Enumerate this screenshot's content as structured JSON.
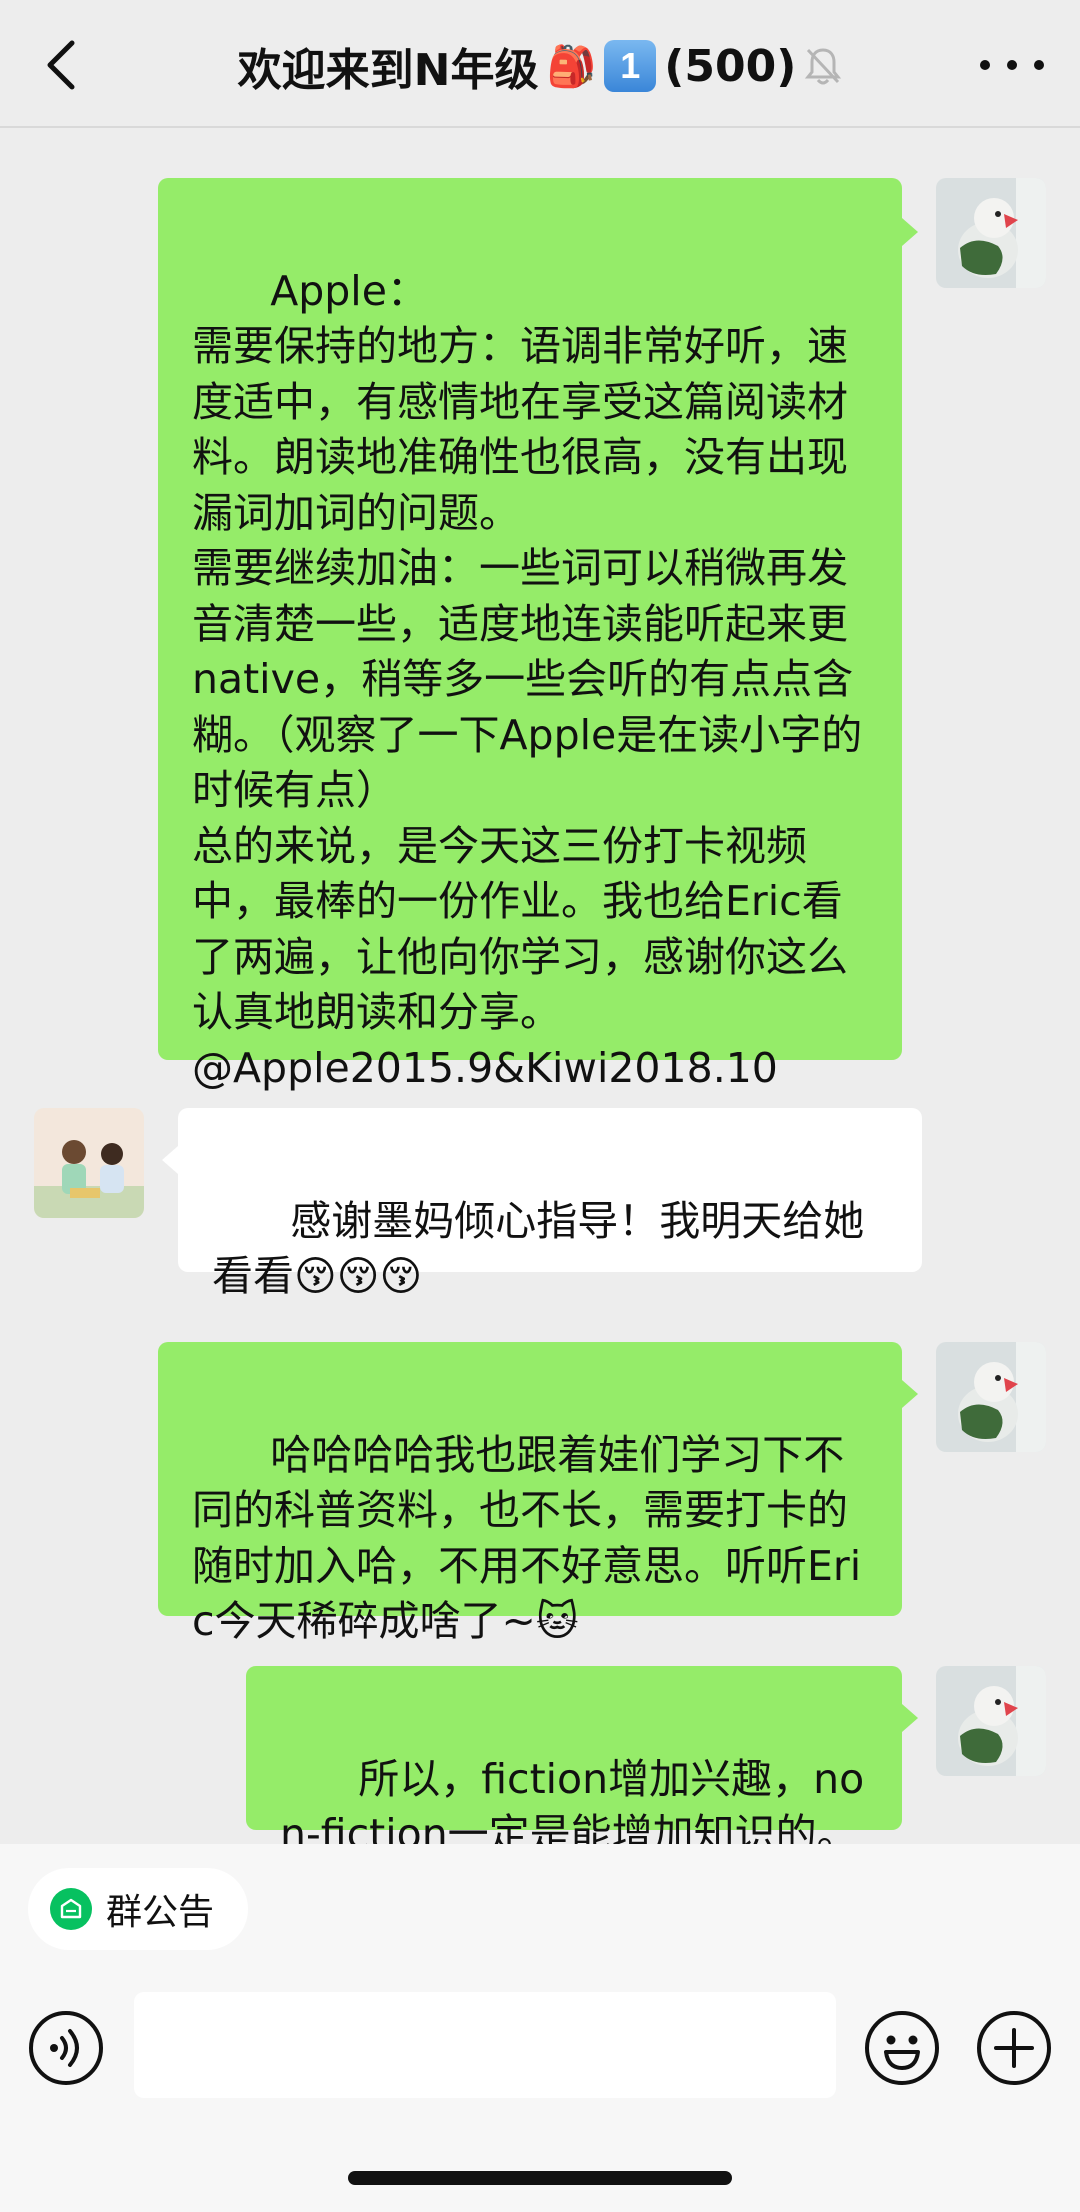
{
  "header": {
    "back_icon": "chevron-left-icon",
    "title": "欢迎来到N年级",
    "title_emoji": "🎒",
    "badge_number": "1",
    "member_count": "(500)",
    "mute_icon": "bell-slash-icon",
    "more_icon": "ellipsis-icon"
  },
  "messages": [
    {
      "side": "right",
      "sender": "self",
      "text": "Apple：\n需要保持的地方：语调非常好听，速度适中，有感情地在享受这篇阅读材料。朗读地准确性也很高，没有出现漏词加词的问题。\n需要继续加油：一些词可以稍微再发音清楚一些，适度地连读能听起来更native，稍等多一些会听的有点点含糊。（观察了一下Apple是在读小字的时候有点）\n总的来说，是今天这三份打卡视频中，最棒的一份作业。我也给Eric看了两遍，让他向你学习，感谢你这么认真地朗读和分享。\n@Apple2015.9&Kiwi2018.10"
    },
    {
      "side": "left",
      "sender": "other",
      "text": "感谢墨妈倾心指导！我明天给她看看😚😚😚"
    },
    {
      "side": "right",
      "sender": "self",
      "text": "哈哈哈哈我也跟着娃们学习下不同的科普资料，也不长，需要打卡的随时加入哈，不用不好意思。听听Eric今天稀碎成啥了~🐱"
    },
    {
      "side": "right",
      "sender": "self",
      "text": "所以，fiction增加兴趣，non-fiction一定是能增加知识的。"
    }
  ],
  "notice": {
    "label": "群公告",
    "icon": "notice-icon"
  },
  "input": {
    "value": "",
    "voice_icon": "voice-icon",
    "emoji_icon": "smiley-icon",
    "plus_icon": "plus-icon"
  },
  "colors": {
    "bubble_self": "#95ec69",
    "bubble_other": "#ffffff",
    "background": "#ededed",
    "accent": "#07c160"
  }
}
